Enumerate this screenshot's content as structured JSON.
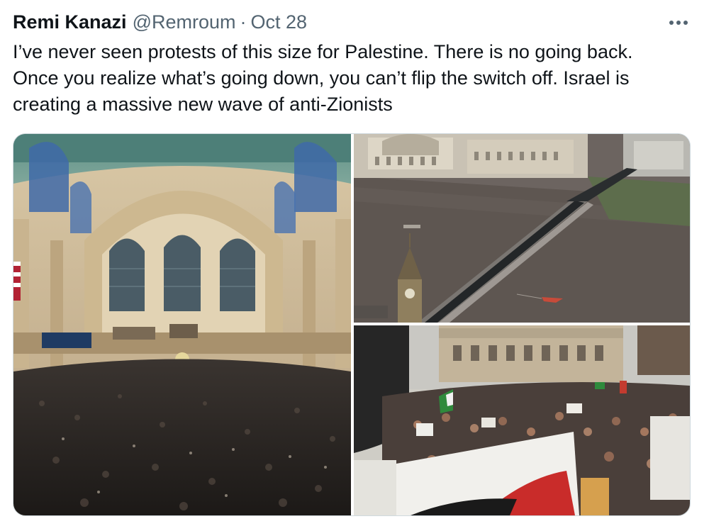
{
  "tweet": {
    "author": {
      "display_name": "Remi Kanazi",
      "handle": "@Remroum"
    },
    "separator": "·",
    "timestamp": "Oct 28",
    "more_icon": "ellipsis-icon",
    "text": "I’ve never seen protests of this size for Palestine. There is no going back.\nOnce you realize what’s going down, you can’t flip the switch off. Israel is\ncreating a massive new wave of anti-Zionists"
  },
  "colors": {
    "text_primary": "#0f1419",
    "text_secondary": "#536471",
    "border": "#cfd9de"
  }
}
